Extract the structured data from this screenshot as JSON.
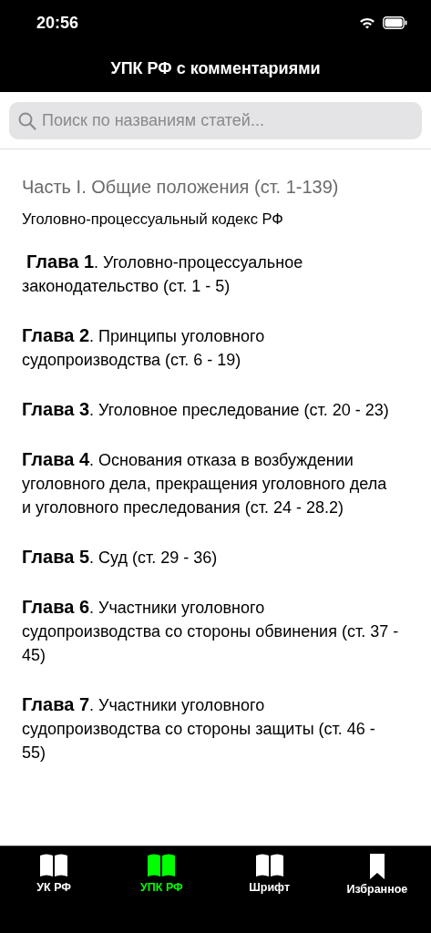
{
  "status_bar": {
    "time": "20:56"
  },
  "nav_bar": {
    "title": "УПК РФ с комментариями"
  },
  "search": {
    "placeholder": "Поиск по названиям статей..."
  },
  "content": {
    "part_title": "Часть I. Общие положения (ст. 1-139)",
    "code_title": "Уголовно-процессуальный кодекс РФ",
    "chapters": [
      {
        "text": " **Глава 1**. Уголовно-процессуальное законодательство (ст. 1 - 5)"
      },
      {
        "text": "**Глава 2**. Принципы уголовного судопроизводства (ст. 6 - 19)"
      },
      {
        "text": "**Глава 3**. Уголовное преследование (ст. 20 - 23)"
      },
      {
        "text": "**Глава 4**. Основания отказа в возбуждении уголовного дела, прекращения уголовного дела и уголовного преследования (ст. 24 - 28.2)"
      },
      {
        "text": "**Глава 5**. Суд (ст. 29 - 36)"
      },
      {
        "text": "**Глава 6**. Участники уголовного судопроизводства со стороны обвинения (ст. 37 - 45)"
      },
      {
        "text": "**Глава 7**. Участники уголовного судопроизводства со стороны защиты (ст. 46 - 55)"
      }
    ]
  },
  "tab_bar": {
    "tabs": [
      {
        "label": "УК РФ",
        "kind": "book",
        "selected": false
      },
      {
        "label": "УПК РФ",
        "kind": "book",
        "selected": true
      },
      {
        "label": "Шрифт",
        "kind": "book",
        "selected": false
      },
      {
        "label": "Избранное",
        "kind": "bookmark",
        "selected": false
      }
    ]
  }
}
